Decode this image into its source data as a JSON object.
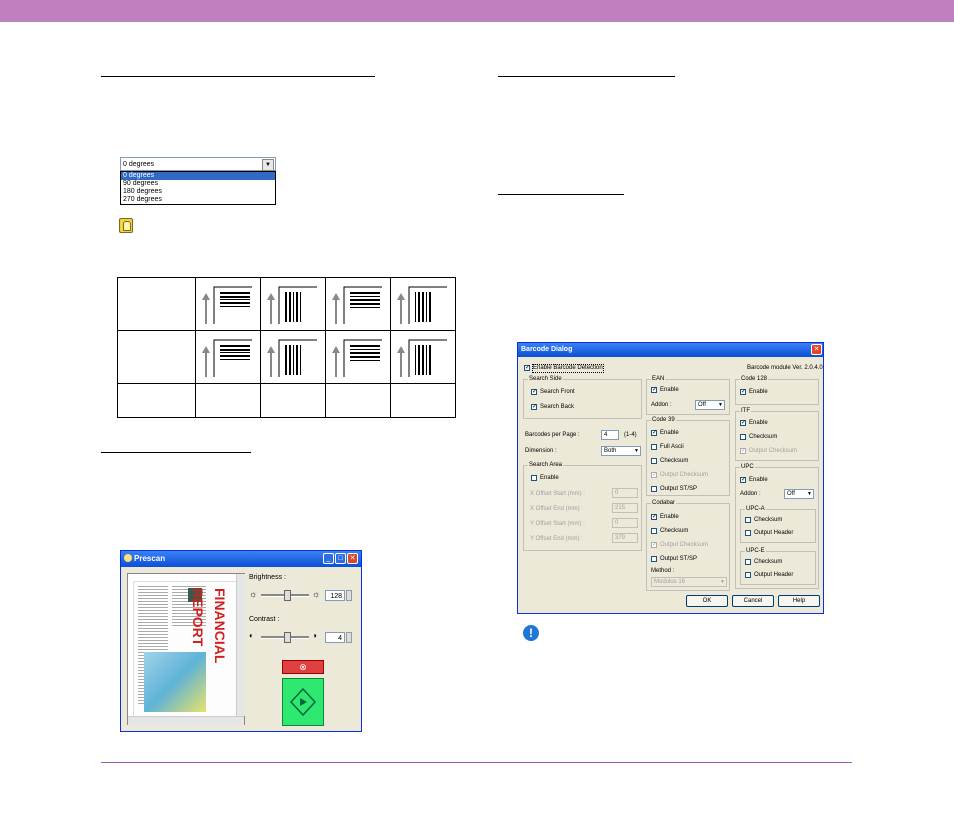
{
  "colors": {
    "header_bar": "#c080c0",
    "footer_line": "#9b59b6",
    "title_bar": "#0a4fd6"
  },
  "rotation": {
    "selected": "0 degrees",
    "options": [
      "0 degrees",
      "90 degrees",
      "180 degrees",
      "270 degrees"
    ]
  },
  "icons": {
    "tip": "lightbulb-icon",
    "important": "exclamation-icon",
    "start": "start-diamond-icon",
    "stop": "stop-icon"
  },
  "prescan": {
    "title": "Prescan",
    "brightness_label": "Brightness :",
    "brightness_value": "128",
    "contrast_label": "Contrast :",
    "contrast_value": "4",
    "preview_text": "FINANCIAL REPORT"
  },
  "barcode": {
    "title": "Barcode Dialog",
    "enable_detection": "Enable Barcode Detection",
    "module_version": "Barcode module Ver. 2.0.4.0",
    "search_side": {
      "label": "Search Side",
      "front": "Search Front",
      "back": "Search Back"
    },
    "per_page_label": "Barcodes per Page :",
    "per_page_value": "4",
    "per_page_range": "(1-4)",
    "dimension_label": "Dimension :",
    "dimension_value": "Both",
    "search_area": {
      "label": "Search Area",
      "enable": "Enable",
      "x_start": "X Offset Start (mm) :",
      "x_start_val": "0",
      "x_end": "X Offset End (mm) :",
      "x_end_val": "215",
      "y_start": "Y Offset Start (mm) :",
      "y_start_val": "0",
      "y_end": "Y Offset End (mm) :",
      "y_end_val": "379"
    },
    "ean": {
      "label": "EAN",
      "enable": "Enable",
      "addon_label": "Addon :",
      "addon_value": "Off"
    },
    "code39": {
      "label": "Code 39",
      "enable": "Enable",
      "full_ascii": "Full Ascii",
      "checksum": "Checksum",
      "output_checksum": "Output Checksum",
      "output_stsp": "Output ST/SP"
    },
    "codabar": {
      "label": "Codabar",
      "enable": "Enable",
      "checksum": "Checksum",
      "output_checksum": "Output Checksum",
      "output_stsp": "Output ST/SP",
      "method_label": "Method :",
      "method_value": "Modulus 16"
    },
    "code128": {
      "label": "Code 128",
      "enable": "Enable"
    },
    "itf": {
      "label": "ITF",
      "enable": "Enable",
      "checksum": "Checksum",
      "output_checksum": "Output Checksum"
    },
    "upc": {
      "label": "UPC",
      "enable": "Enable",
      "addon_label": "Addon :",
      "addon_value": "Off",
      "upca": {
        "label": "UPC-A",
        "checksum": "Checksum",
        "output_header": "Output Header"
      },
      "upce": {
        "label": "UPC-E",
        "checksum": "Checksum",
        "output_header": "Output Header"
      }
    },
    "ok": "OK",
    "cancel": "Cancel",
    "help": "Help"
  }
}
